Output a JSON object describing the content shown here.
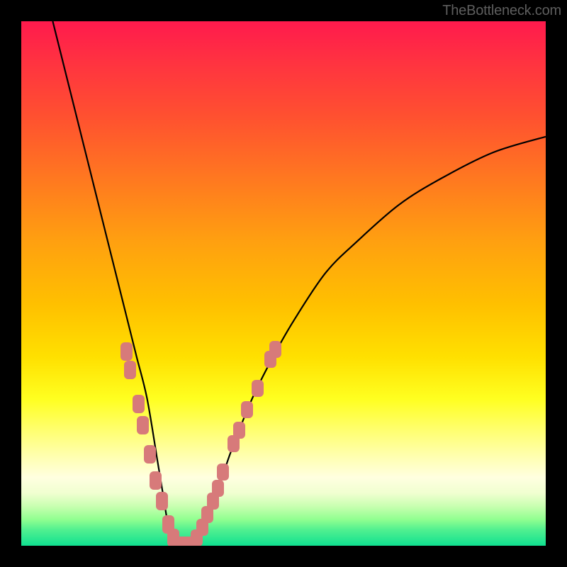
{
  "watermark": "TheBottleneck.com",
  "colors": {
    "dot": "#d77a7a",
    "curve": "#000000"
  },
  "chart_data": {
    "type": "line",
    "title": "",
    "xlabel": "",
    "ylabel": "",
    "xlim": [
      0,
      100
    ],
    "ylim": [
      0,
      100
    ],
    "grid": false,
    "legend": false,
    "series": [
      {
        "name": "bottleneck-curve",
        "x": [
          6,
          8,
          10,
          12,
          14,
          16,
          18,
          20,
          22,
          24,
          26,
          27,
          28,
          29,
          30,
          32,
          34,
          36,
          38,
          40,
          44,
          48,
          52,
          58,
          64,
          72,
          80,
          90,
          100
        ],
        "y": [
          100,
          92,
          84,
          76,
          68,
          60,
          52,
          44,
          36,
          28,
          16,
          10,
          4,
          1,
          0,
          0,
          2,
          6,
          12,
          18,
          28,
          36,
          43,
          52,
          58,
          65,
          70,
          75,
          78
        ]
      }
    ],
    "dots_left": [
      {
        "x": 20.0,
        "y": 37.0
      },
      {
        "x": 20.8,
        "y": 33.5
      },
      {
        "x": 22.3,
        "y": 27.0
      },
      {
        "x": 23.2,
        "y": 23.0
      },
      {
        "x": 24.5,
        "y": 17.5
      },
      {
        "x": 25.6,
        "y": 12.5
      },
      {
        "x": 26.8,
        "y": 8.5
      },
      {
        "x": 28.0,
        "y": 4.0
      },
      {
        "x": 29.0,
        "y": 1.5
      }
    ],
    "dots_bottom": [
      {
        "x": 29.5,
        "y": 0.5
      },
      {
        "x": 30.5,
        "y": 0.5
      },
      {
        "x": 31.5,
        "y": 0.5
      },
      {
        "x": 32.5,
        "y": 0.5
      }
    ],
    "dots_right": [
      {
        "x": 33.5,
        "y": 1.5
      },
      {
        "x": 34.5,
        "y": 3.5
      },
      {
        "x": 35.5,
        "y": 6.0
      },
      {
        "x": 36.5,
        "y": 8.5
      },
      {
        "x": 37.5,
        "y": 11.0
      },
      {
        "x": 38.5,
        "y": 14.0
      },
      {
        "x": 40.5,
        "y": 19.5
      },
      {
        "x": 41.5,
        "y": 22.0
      },
      {
        "x": 43.0,
        "y": 26.0
      },
      {
        "x": 45.0,
        "y": 30.0
      },
      {
        "x": 47.5,
        "y": 35.5
      },
      {
        "x": 48.5,
        "y": 37.5
      }
    ]
  }
}
